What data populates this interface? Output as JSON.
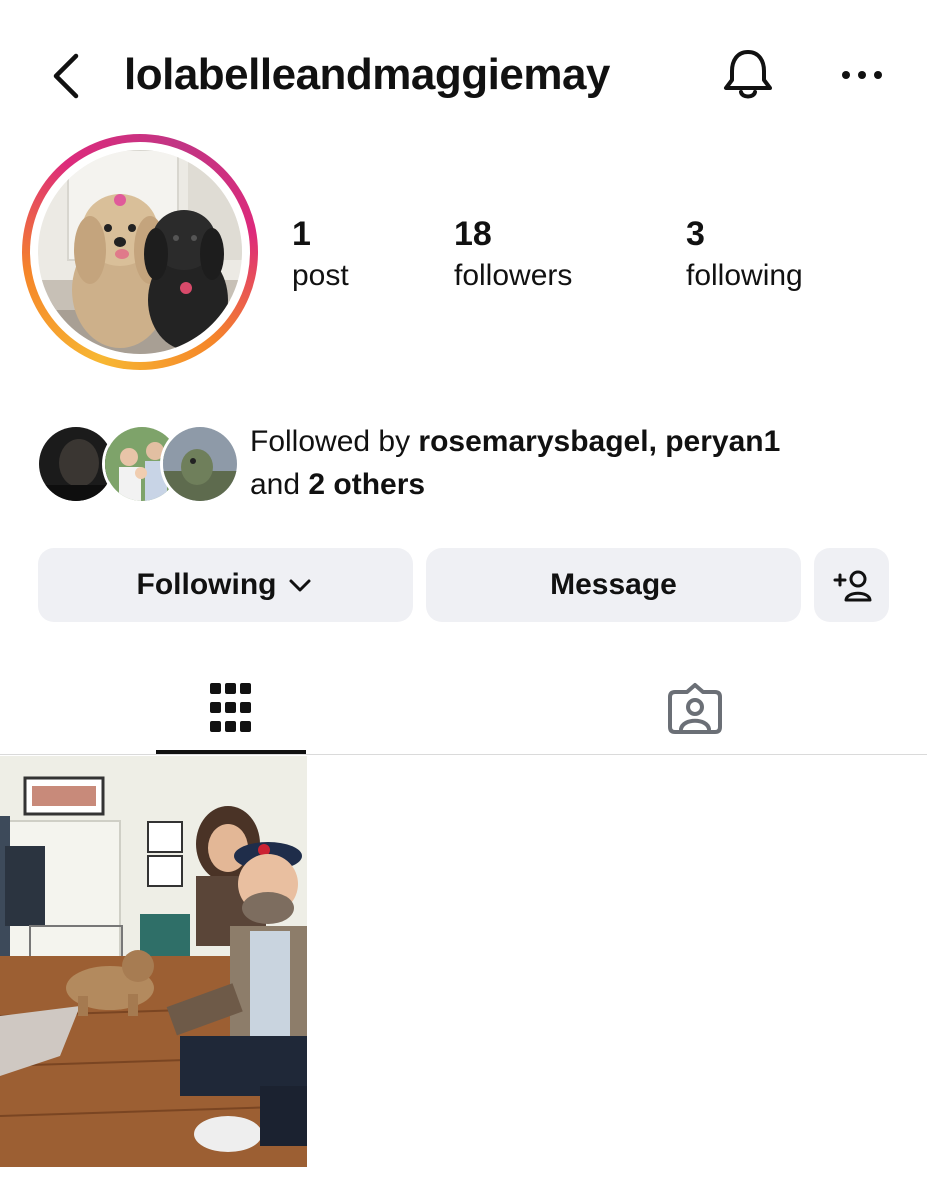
{
  "header": {
    "username": "lolabelleandmaggiemay"
  },
  "stats": [
    {
      "value": "1",
      "label": "post"
    },
    {
      "value": "18",
      "label": "followers"
    },
    {
      "value": "3",
      "label": "following"
    }
  ],
  "followed_by": {
    "prefix": "Followed by ",
    "user1": "rosemarysbagel",
    "separator": ", ",
    "user2": "peryan1",
    "conjunction": "and ",
    "others": "2 others"
  },
  "actions": {
    "following_label": "Following",
    "message_label": "Message"
  },
  "tabs": [
    {
      "name": "posts-grid",
      "icon": "grid-icon",
      "active": true
    },
    {
      "name": "tagged",
      "icon": "tagged-person-icon",
      "active": false
    }
  ],
  "colors": {
    "button_bg": "#eff0f4",
    "story_ring_start": "#f7b733",
    "story_ring_mid": "#dd2a7b",
    "story_ring_end": "#c13584"
  }
}
